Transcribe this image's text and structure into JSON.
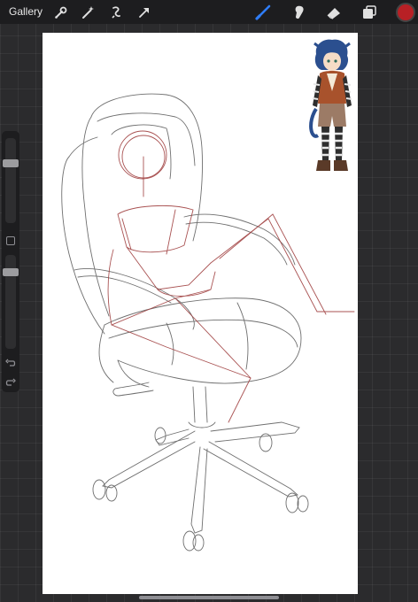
{
  "topbar": {
    "gallery_label": "Gallery",
    "left_tools": [
      "wrench-icon",
      "magic-wand-icon",
      "selection-icon",
      "transform-arrow-icon"
    ],
    "right_tools": [
      "brush-icon",
      "smudge-icon",
      "eraser-icon",
      "layers-icon"
    ],
    "active_tool": "brush-icon",
    "current_color": "#b82025",
    "accent_color": "#2f7df6"
  },
  "sidebar": {
    "brush_size_level": 0.28,
    "brush_opacity_level": 0.6,
    "icons": [
      "modify-square-icon",
      "undo-icon",
      "redo-icon"
    ]
  },
  "canvas": {
    "background": "#ffffff",
    "sketch_line_color": "#6f6f6f",
    "guide_line_color": "#a04040",
    "reference_image": "anime-boy-character-reference"
  }
}
